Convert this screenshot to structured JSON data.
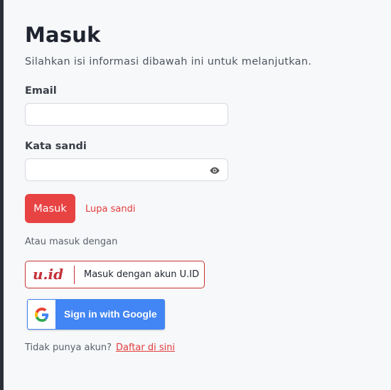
{
  "page": {
    "title": "Masuk",
    "subtitle": "Silahkan isi informasi dibawah ini untuk melanjutkan."
  },
  "form": {
    "email_label": "Email",
    "email_value": "",
    "password_label": "Kata sandi",
    "password_value": "",
    "password_toggle_icon": "eye-icon",
    "submit_label": "Masuk",
    "forgot_label": "Lupa sandi"
  },
  "alt_login": {
    "divider_text": "Atau masuk dengan",
    "uid_logo_text": "u.id",
    "uid_button_label": "Masuk dengan akun U.ID",
    "google_button_label": "Sign in with Google"
  },
  "footer": {
    "no_account_text": "Tidak punya akun?",
    "register_link": "Daftar di sini"
  },
  "colors": {
    "accent_red": "#e84343",
    "google_blue": "#4285f4",
    "background": "#f7f8fa"
  }
}
